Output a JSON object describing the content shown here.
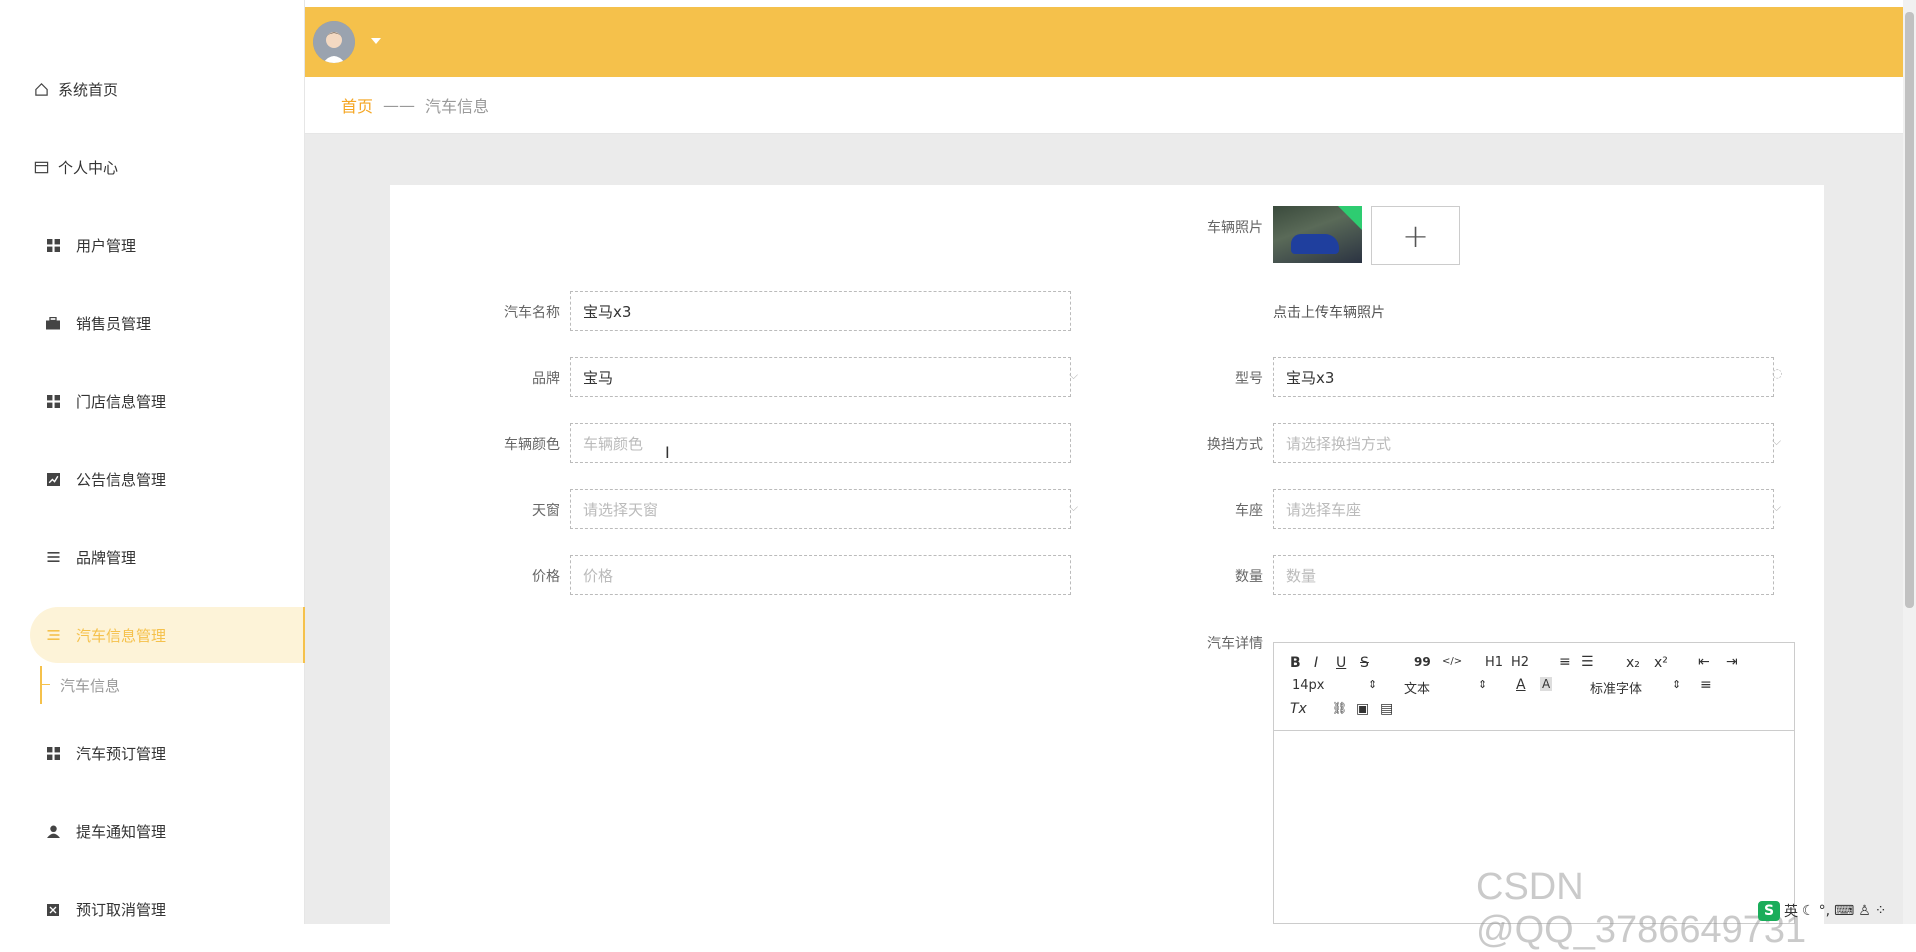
{
  "sidebar": {
    "items": [
      {
        "label": "系统首页",
        "icon": "home-icon"
      },
      {
        "label": "个人中心",
        "icon": "card-icon"
      },
      {
        "label": "用户管理",
        "icon": "grid-icon"
      },
      {
        "label": "销售员管理",
        "icon": "briefcase-icon"
      },
      {
        "label": "门店信息管理",
        "icon": "grid-icon"
      },
      {
        "label": "公告信息管理",
        "icon": "chart-icon"
      },
      {
        "label": "品牌管理",
        "icon": "list-icon"
      },
      {
        "label": "汽车信息管理",
        "icon": "sliders-icon"
      },
      {
        "label": "汽车预订管理",
        "icon": "grid-icon"
      },
      {
        "label": "提车通知管理",
        "icon": "user-icon"
      },
      {
        "label": "预订取消管理",
        "icon": "box-x-icon"
      }
    ],
    "sub_item": "汽车信息",
    "accent": "#f5c14b"
  },
  "breadcrumb": {
    "home": "首页",
    "sep": "——",
    "current": "汽车信息"
  },
  "form": {
    "car_name": {
      "label": "汽车名称",
      "value": "宝马x3"
    },
    "brand": {
      "label": "品牌",
      "value": "宝马"
    },
    "color": {
      "label": "车辆颜色",
      "placeholder": "车辆颜色"
    },
    "sunroof": {
      "label": "天窗",
      "placeholder": "请选择天窗"
    },
    "price": {
      "label": "价格",
      "placeholder": "价格"
    },
    "photo": {
      "label": "车辆照片",
      "hint": "点击上传车辆照片",
      "add": "+"
    },
    "model": {
      "label": "型号",
      "value": "宝马x3"
    },
    "gearbox": {
      "label": "换挡方式",
      "placeholder": "请选择换挡方式"
    },
    "seats": {
      "label": "车座",
      "placeholder": "请选择车座"
    },
    "quantity": {
      "label": "数量",
      "placeholder": "数量"
    },
    "details": {
      "label": "汽车详情"
    }
  },
  "editor": {
    "row1": [
      "B",
      "I",
      "U",
      "S",
      "99",
      "</>",
      "H1",
      "H2",
      "≡",
      "☰",
      "x₂",
      "x²",
      "⇤",
      "⇥"
    ],
    "font_size": "14px",
    "text_type": "文本",
    "font_family": "标准字体",
    "row3": [
      "Tx",
      "🔗",
      "▣",
      "▤"
    ]
  },
  "watermark": "CSDN @QQ_3786649731",
  "ime": {
    "lang": "英"
  }
}
